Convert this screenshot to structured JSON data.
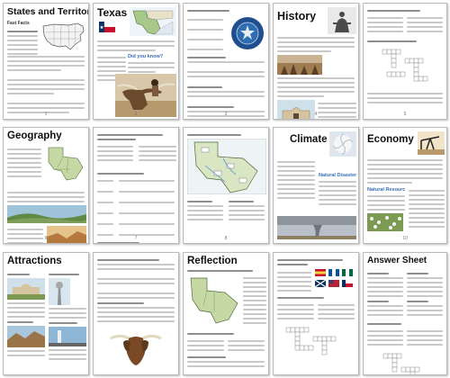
{
  "pages": [
    {
      "id": "states",
      "title": "States and Territories",
      "subtitle": "Fast Facts",
      "page_number": "1"
    },
    {
      "id": "texas",
      "title": "Texas",
      "callout": "Did you know?",
      "page_number": "2"
    },
    {
      "id": "worksheet1",
      "title": "",
      "page_number": "3"
    },
    {
      "id": "history",
      "title": "History",
      "page_number": "4"
    },
    {
      "id": "worksheet2",
      "title": "",
      "page_number": "5"
    },
    {
      "id": "geography",
      "title": "Geography",
      "page_number": "6"
    },
    {
      "id": "worksheet3",
      "title": "",
      "page_number": "7"
    },
    {
      "id": "map",
      "title": "",
      "page_number": "8"
    },
    {
      "id": "climate",
      "title": "Climate",
      "callout": "Natural Disasters",
      "page_number": "9"
    },
    {
      "id": "economy",
      "title": "Economy",
      "callout": "Natural Resources",
      "page_number": "10"
    },
    {
      "id": "attractions",
      "title": "Attractions",
      "page_number": "11"
    },
    {
      "id": "worksheet4",
      "title": "",
      "page_number": "12"
    },
    {
      "id": "reflection",
      "title": "Reflection",
      "page_number": "13"
    },
    {
      "id": "worksheet5",
      "title": "",
      "page_number": "14"
    },
    {
      "id": "answers",
      "title": "Answer Sheet",
      "page_number": "15"
    }
  ],
  "colors": {
    "page_bg": "#ffffff",
    "border": "#b9b9b9",
    "title": "#111111",
    "callout_blue": "#3a6fb5",
    "flag_red": "#c8102e",
    "flag_blue": "#0a3161",
    "map_green": "#a9c98a",
    "desert": "#c9a46a"
  }
}
